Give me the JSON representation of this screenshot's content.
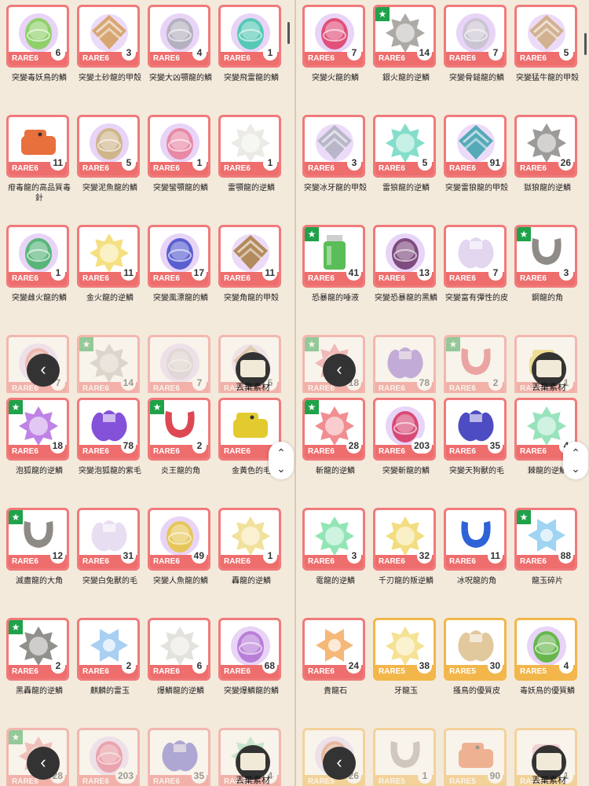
{
  "quadrants": [
    {
      "rows": [
        [
          {
            "name": "突變毒妖鳥的鱗",
            "rarity": "RARE6",
            "count": "6",
            "star": false,
            "icon": "scale-orb-green",
            "color": "#8fd06a"
          },
          {
            "name": "突變土砂龍的甲殼",
            "rarity": "RARE6",
            "count": "3",
            "star": false,
            "icon": "shell-plate-tan",
            "color": "#d7a672"
          },
          {
            "name": "突變大凶顎龍的鱗",
            "rarity": "RARE6",
            "count": "4",
            "star": false,
            "icon": "scale-orb-gray",
            "color": "#b4b0bf"
          },
          {
            "name": "突變飛雷龍的鱗",
            "rarity": "RARE6",
            "count": "1",
            "star": false,
            "icon": "scale-orb-teal",
            "color": "#56c9b6"
          }
        ],
        [
          {
            "name": "疳毒龍的高品質毒針",
            "rarity": "RARE6",
            "count": "11",
            "star": false,
            "icon": "creature-orange",
            "color": "#e8703d"
          },
          {
            "name": "突變泥魚龍的鱗",
            "rarity": "RARE6",
            "count": "5",
            "star": false,
            "icon": "scale-orb-tan",
            "color": "#cfb58a"
          },
          {
            "name": "突變蠻顎龍的鱗",
            "rarity": "RARE6",
            "count": "1",
            "star": false,
            "icon": "scale-orb-pink",
            "color": "#e889a5"
          },
          {
            "name": "雷顎龍的逆鱗",
            "rarity": "RARE6",
            "count": "1",
            "star": false,
            "icon": "spike-orb-white",
            "color": "#e9e6e0"
          }
        ],
        [
          {
            "name": "突變雌火龍的鱗",
            "rarity": "RARE6",
            "count": "1",
            "star": false,
            "icon": "scale-orb-green",
            "color": "#58b57a"
          },
          {
            "name": "金火龍的逆鱗",
            "rarity": "RARE6",
            "count": "11",
            "star": false,
            "icon": "spike-orb-yellow",
            "color": "#f3da6b"
          },
          {
            "name": "突變風漂龍的鱗",
            "rarity": "RARE6",
            "count": "17",
            "star": false,
            "icon": "scale-orb-blue",
            "color": "#5a5fd0"
          },
          {
            "name": "突變角龍的甲殼",
            "rarity": "RARE6",
            "count": "11",
            "star": false,
            "icon": "shell-plate-brown",
            "color": "#b38a5c"
          }
        ],
        [
          {
            "name": "",
            "rarity": "RARE6",
            "count": "7",
            "star": false,
            "icon": "scale-orb-red",
            "color": "#e87a7a"
          },
          {
            "name": "",
            "rarity": "RARE6",
            "count": "14",
            "star": true,
            "icon": "spike-orb-gray",
            "color": "#b3b0ab"
          },
          {
            "name": "",
            "rarity": "RARE6",
            "count": "7",
            "star": false,
            "icon": "scale-orb-gray",
            "color": "#c9c3cf"
          },
          {
            "name": "",
            "rarity": "RARE6",
            "count": "5",
            "star": false,
            "icon": "shell-plate-tan",
            "color": "#c8a77d"
          }
        ]
      ]
    },
    {
      "rows": [
        [
          {
            "name": "突變火龍的鱗",
            "rarity": "RARE6",
            "count": "7",
            "star": false,
            "icon": "scale-orb-red",
            "color": "#e0507a"
          },
          {
            "name": "銀火龍的逆鱗",
            "rarity": "RARE6",
            "count": "14",
            "star": true,
            "icon": "spike-orb-gray",
            "color": "#9f9b96"
          },
          {
            "name": "突變骨鎚龍的鱗",
            "rarity": "RARE6",
            "count": "7",
            "star": false,
            "icon": "scale-orb-gray",
            "color": "#cbc4d3"
          },
          {
            "name": "突變猛牛龍的甲殼",
            "rarity": "RARE6",
            "count": "5",
            "star": false,
            "icon": "shell-plate-tan",
            "color": "#d1b190"
          }
        ],
        [
          {
            "name": "突變冰牙龍的甲殼",
            "rarity": "RARE6",
            "count": "3",
            "star": false,
            "icon": "shell-plate-gray",
            "color": "#b8b6c8"
          },
          {
            "name": "雷狼龍的逆鱗",
            "rarity": "RARE6",
            "count": "5",
            "star": false,
            "icon": "spike-orb-teal",
            "color": "#6fd8c2"
          },
          {
            "name": "突變雷狼龍的甲殼",
            "rarity": "RARE6",
            "count": "91",
            "star": false,
            "icon": "shell-plate-teal",
            "color": "#55a9b8"
          },
          {
            "name": "獄狼龍的逆鱗",
            "rarity": "RARE6",
            "count": "26",
            "star": false,
            "icon": "spike-orb-gray",
            "color": "#8c8a88"
          }
        ],
        [
          {
            "name": "恐暴龍的唾液",
            "rarity": "RARE6",
            "count": "41",
            "star": true,
            "icon": "bottle-green",
            "color": "#5bbd57"
          },
          {
            "name": "突變恐暴龍的黑鱗",
            "rarity": "RARE6",
            "count": "13",
            "star": false,
            "icon": "scale-orb-dark",
            "color": "#7e4c7f"
          },
          {
            "name": "突變富有彈性的皮",
            "rarity": "RARE6",
            "count": "7",
            "star": false,
            "icon": "hide-lavender",
            "color": "#e3d6ef"
          },
          {
            "name": "鋼龍的角",
            "rarity": "RARE6",
            "count": "3",
            "star": true,
            "icon": "horn-gray",
            "color": "#8f8c88"
          }
        ],
        [
          {
            "name": "",
            "rarity": "RARE6",
            "count": "18",
            "star": true,
            "icon": "spike-orb-red",
            "color": "#e86b78"
          },
          {
            "name": "",
            "rarity": "RARE6",
            "count": "78",
            "star": false,
            "icon": "hide-purple",
            "color": "#8a5fd4"
          },
          {
            "name": "",
            "rarity": "RARE6",
            "count": "2",
            "star": true,
            "icon": "horn-red",
            "color": "#e0515a"
          },
          {
            "name": "",
            "rarity": "RARE6",
            "count": "1",
            "star": false,
            "icon": "creature-yellow",
            "color": "#e7cf3b"
          }
        ]
      ]
    },
    {
      "rows": [
        [
          {
            "name": "泡狐龍的逆鱗",
            "rarity": "RARE6",
            "count": "18",
            "star": true,
            "icon": "spike-orb-purple",
            "color": "#b46de0"
          },
          {
            "name": "突變泡狐龍的紫毛",
            "rarity": "RARE6",
            "count": "78",
            "star": false,
            "icon": "hide-purple",
            "color": "#8452d9"
          },
          {
            "name": "炎王龍的角",
            "rarity": "RARE6",
            "count": "2",
            "star": true,
            "icon": "horn-red",
            "color": "#dd4852"
          },
          {
            "name": "金黃色的毛",
            "rarity": "RARE6",
            "count": "",
            "star": false,
            "icon": "creature-yellow",
            "color": "#e3cb2f"
          }
        ],
        [
          {
            "name": "滅盡龍的大角",
            "rarity": "RARE6",
            "count": "12",
            "star": true,
            "icon": "horn-gray",
            "color": "#8e8b86"
          },
          {
            "name": "突變白兔獸的毛",
            "rarity": "RARE6",
            "count": "31",
            "star": false,
            "icon": "hide-lavender",
            "color": "#e8def2"
          },
          {
            "name": "突變人魚龍的鱗",
            "rarity": "RARE6",
            "count": "49",
            "star": false,
            "icon": "scale-orb-yellow",
            "color": "#e6c658"
          },
          {
            "name": "轟龍的逆鱗",
            "rarity": "RARE6",
            "count": "1",
            "star": false,
            "icon": "spike-orb-yellow",
            "color": "#f0dc8a"
          }
        ],
        [
          {
            "name": "黑轟龍的逆鱗",
            "rarity": "RARE6",
            "count": "2",
            "star": true,
            "icon": "spike-orb-gray",
            "color": "#7f7c78"
          },
          {
            "name": "麒麟的雷玉",
            "rarity": "RARE6",
            "count": "2",
            "star": false,
            "icon": "jewel-blue",
            "color": "#a9cff2"
          },
          {
            "name": "爆鱗龍的逆鱗",
            "rarity": "RARE6",
            "count": "6",
            "star": false,
            "icon": "spike-orb-white",
            "color": "#dfddd6"
          },
          {
            "name": "突變爆鱗龍的鱗",
            "rarity": "RARE6",
            "count": "68",
            "star": false,
            "icon": "scale-orb-purple",
            "color": "#b97fd8"
          }
        ],
        [
          {
            "name": "",
            "rarity": "RARE6",
            "count": "28",
            "star": true,
            "icon": "spike-orb-red",
            "color": "#e87a80"
          },
          {
            "name": "",
            "rarity": "RARE6",
            "count": "203",
            "star": false,
            "icon": "scale-orb-red",
            "color": "#e0507a"
          },
          {
            "name": "",
            "rarity": "RARE6",
            "count": "35",
            "star": false,
            "icon": "hide-purple",
            "color": "#5a56c9"
          },
          {
            "name": "",
            "rarity": "RARE6",
            "count": "4",
            "star": false,
            "icon": "spike-orb-teal",
            "color": "#7fdcaa"
          }
        ]
      ]
    },
    {
      "rows": [
        [
          {
            "name": "斬龍的逆鱗",
            "rarity": "RARE6",
            "count": "28",
            "star": true,
            "icon": "spike-orb-red",
            "color": "#ef7a7e"
          },
          {
            "name": "突變斬龍的鱗",
            "rarity": "RARE6",
            "count": "203",
            "star": false,
            "icon": "scale-orb-red",
            "color": "#d84a76"
          },
          {
            "name": "突變天狗獸的毛",
            "rarity": "RARE6",
            "count": "35",
            "star": false,
            "icon": "hide-purple",
            "color": "#4e4cc2"
          },
          {
            "name": "棘龍的逆鱗",
            "rarity": "RARE6",
            "count": "4",
            "star": false,
            "icon": "spike-orb-teal",
            "color": "#86deb1"
          }
        ],
        [
          {
            "name": "電龍的逆鱗",
            "rarity": "RARE6",
            "count": "3",
            "star": false,
            "icon": "spike-orb-teal",
            "color": "#7fe0a8"
          },
          {
            "name": "千刃龍的叛逆鱗",
            "rarity": "RARE6",
            "count": "32",
            "star": false,
            "icon": "spike-orb-yellow",
            "color": "#f0d86a"
          },
          {
            "name": "冰呪龍的角",
            "rarity": "RARE6",
            "count": "11",
            "star": false,
            "icon": "horn-blue",
            "color": "#2f62d6"
          },
          {
            "name": "龍玉碎片",
            "rarity": "RARE6",
            "count": "88",
            "star": true,
            "icon": "jewel-blue",
            "color": "#9fd4f2"
          }
        ],
        [
          {
            "name": "貴龍石",
            "rarity": "RARE6",
            "count": "24",
            "star": false,
            "icon": "jewel-orange",
            "color": "#f4b878"
          },
          {
            "name": "牙龍玉",
            "rarity": "RARE5",
            "count": "38",
            "star": false,
            "icon": "spike-orb-yellow",
            "color": "#f3dd82"
          },
          {
            "name": "搔鳥的優質皮",
            "rarity": "RARE5",
            "count": "30",
            "star": false,
            "icon": "hide-tan",
            "color": "#e2c89d"
          },
          {
            "name": "毒妖鳥的優質鱗",
            "rarity": "RARE5",
            "count": "4",
            "star": false,
            "icon": "scale-orb-green",
            "color": "#66b64c"
          }
        ],
        [
          {
            "name": "",
            "rarity": "RARE5",
            "count": "26",
            "star": false,
            "icon": "scale-orb-red",
            "color": "#d67a5a"
          },
          {
            "name": "",
            "rarity": "RARE5",
            "count": "1",
            "star": false,
            "icon": "horn-gray",
            "color": "#a5a19b"
          },
          {
            "name": "",
            "rarity": "RARE5",
            "count": "90",
            "star": false,
            "icon": "creature-orange",
            "color": "#e8703d"
          },
          {
            "name": "",
            "rarity": "RARE5",
            "count": "1",
            "star": false,
            "icon": "gem-pink",
            "color": "#eab3c9"
          }
        ]
      ]
    }
  ],
  "overlay": {
    "back_label": "‹",
    "discard_label": "丟棄素材",
    "up_label": "⌃",
    "down_label": "⌄"
  }
}
